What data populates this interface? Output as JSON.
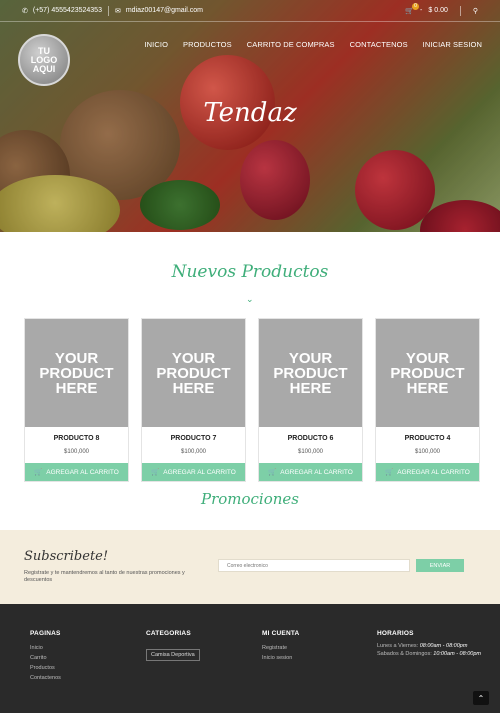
{
  "topbar": {
    "phone": "(+57) 4555423524353",
    "email": "mdiaz00147@gmail.com",
    "cart_count": "0",
    "cart_total": "$ 0.00"
  },
  "logo": {
    "line1": "TU",
    "line2": "LOGO",
    "line3": "AQUI"
  },
  "nav": [
    "INICIO",
    "PRODUCTOS",
    "CARRITO DE COMPRAS",
    "CONTACTENOS",
    "INICIAR SESION"
  ],
  "hero": {
    "title": "Tendaz"
  },
  "new_products": {
    "title": "Nuevos Productos",
    "items": [
      {
        "image_line1": "YOUR",
        "image_line2": "PRODUCT",
        "image_line3": "HERE",
        "name": "PRODUCTO 8",
        "price": "$100,000",
        "button": "AGREGAR AL CARRITO"
      },
      {
        "image_line1": "YOUR",
        "image_line2": "PRODUCT",
        "image_line3": "HERE",
        "name": "PRODUCTO 7",
        "price": "$100,000",
        "button": "AGREGAR AL CARRITO"
      },
      {
        "image_line1": "YOUR",
        "image_line2": "PRODUCT",
        "image_line3": "HERE",
        "name": "PRODUCTO 6",
        "price": "$100,000",
        "button": "AGREGAR AL CARRITO"
      },
      {
        "image_line1": "YOUR",
        "image_line2": "PRODUCT",
        "image_line3": "HERE",
        "name": "PRODUCTO 4",
        "price": "$100,000",
        "button": "AGREGAR AL CARRITO"
      }
    ]
  },
  "promotions": {
    "title": "Promociones"
  },
  "subscribe": {
    "title": "Subscribete!",
    "description": "Registrate y te mantendremos al tanto de nuestras promociones y descuentos",
    "placeholder": "Correo electronico",
    "button": "ENVIAR"
  },
  "footer": {
    "paginas": {
      "title": "PAGINAS",
      "links": [
        "Inicio",
        "Carrito",
        "Productos",
        "Contactenos"
      ]
    },
    "categorias": {
      "title": "CATEGORIAS",
      "items": [
        "Camisa Deportiva"
      ]
    },
    "cuenta": {
      "title": "MI CUENTA",
      "links": [
        "Registrate",
        "Inicio sesion"
      ]
    },
    "horarios": {
      "title": "HORARIOS",
      "rows": [
        {
          "label": "Lunes a Viernes:",
          "value": "08:00am - 08:00pm"
        },
        {
          "label": "Sabados & Domingos:",
          "value": "10:00am - 08:00pm"
        }
      ]
    }
  },
  "colors": {
    "accent": "#3fae7a",
    "button": "#7dcfa7",
    "footer_bg": "#2a2a2a",
    "subscribe_bg": "#f4eddd"
  },
  "icons": [
    "phone-icon",
    "mail-icon",
    "cart-icon",
    "search-icon",
    "chevron-down-icon",
    "chevron-up-icon"
  ]
}
